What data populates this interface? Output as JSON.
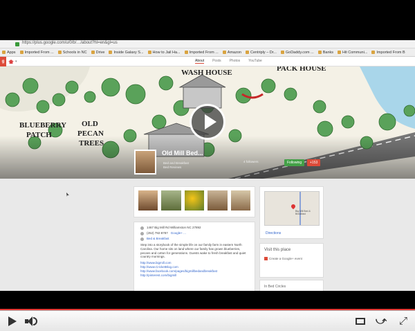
{
  "browser": {
    "url": "https://plus.google.com/u/0/b/…/about?hl=en&gl=us",
    "bookmarks": [
      {
        "label": "Apps"
      },
      {
        "label": "Imported From ..."
      },
      {
        "label": "Schools in NC"
      },
      {
        "label": "Drive"
      },
      {
        "label": "Inside Galaxy S..."
      },
      {
        "label": "How to Jail Ha..."
      },
      {
        "label": "Imported From ..."
      },
      {
        "label": "Amazon"
      },
      {
        "label": "Centriply – Dr..."
      },
      {
        "label": "GoDaddy.com ..."
      },
      {
        "label": "Banks"
      },
      {
        "label": "Hit Communi..."
      },
      {
        "label": "Imported From B"
      }
    ]
  },
  "profile_tabs": [
    "About",
    "Posts",
    "Photos",
    "YouTube"
  ],
  "cover": {
    "labels": [
      "WASH HOUSE",
      "PACK HOUSE",
      "BLUEBERRY PATCH",
      "OLD PECAN TREES"
    ],
    "name": "Old Mill Bed...",
    "meta_line1": "Bed and Breakfast",
    "meta_line2": "Bed Reviews",
    "meta_right": "4 followers",
    "follow_label": "Following",
    "plus_label": "+153"
  },
  "about": {
    "address": "1467 Big Mill Rd Williamston NC 27892",
    "phone": "(252) 792-8787",
    "maps_link": "Google+ ...",
    "category": "Bed & Breakfast",
    "description": "Step into a storybook of the simple life on our family farm in eastern North Carolina. Our home sits on land where our family has grown blueberries, pecans and cotton for generations. Guests wake to fresh breakfast and quiet country mornings.",
    "links": [
      "http://www.bigmill.com",
      "http://www.CricketBlog.com",
      "http://www.facebook.com/pages/bigmillbedandbreakfast",
      "http://pinterest.com/bigmill"
    ]
  },
  "map_card": {
    "label": "Big Mill Bed & Breakfast",
    "directions": "Directions"
  },
  "visit": {
    "title": "Visit this place",
    "action": "Create a Google+ event"
  },
  "circles_title": "In Bed Circles",
  "player": {
    "progress_pct": 100
  }
}
